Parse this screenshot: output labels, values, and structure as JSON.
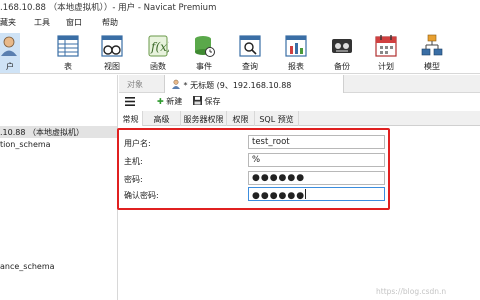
{
  "window": {
    "title": ".168.10.88 （本地虚拟机））- 用户 - Navicat Premium"
  },
  "menu": [
    "藏夹",
    "工具",
    "窗口",
    "帮助"
  ],
  "toolbar": {
    "items": [
      {
        "label": "户",
        "icon": "user-icon"
      },
      {
        "label": "表",
        "icon": "table-icon"
      },
      {
        "label": "视图",
        "icon": "view-icon"
      },
      {
        "label": "函数",
        "icon": "function-icon"
      },
      {
        "label": "事件",
        "icon": "event-icon"
      },
      {
        "label": "查询",
        "icon": "query-icon"
      },
      {
        "label": "报表",
        "icon": "report-icon"
      },
      {
        "label": "备份",
        "icon": "backup-icon"
      },
      {
        "label": "计划",
        "icon": "schedule-icon"
      },
      {
        "label": "模型",
        "icon": "model-icon"
      }
    ]
  },
  "sidebar": {
    "items": [
      {
        "label": ".10.88 （本地虚拟机）",
        "selected": true
      },
      {
        "label": "tion_schema",
        "selected": false
      },
      {
        "label": "ance_schema",
        "selected": false
      }
    ]
  },
  "tabs": {
    "objects": "对象",
    "active": "* 无标题 (9、192.168.10.88"
  },
  "object_toolbar": {
    "menu_icon": "hamburger-icon",
    "new_label": "新建",
    "save_label": "保存"
  },
  "subtabs": [
    "常规",
    "高级",
    "服务器权限",
    "权限",
    "SQL 预览"
  ],
  "form": {
    "fields": [
      {
        "label": "用户名:",
        "value": "test_root"
      },
      {
        "label": "主机:",
        "value": "%"
      },
      {
        "label": "密码:",
        "value": "●●●●●●"
      },
      {
        "label": "确认密码:",
        "value": "●●●●●●"
      }
    ]
  },
  "colors": {
    "highlight_border": "#e02020",
    "focus_border": "#3c8dde",
    "selected_row": "#e3e3e3"
  },
  "watermark": "https://blog.csdn.n"
}
